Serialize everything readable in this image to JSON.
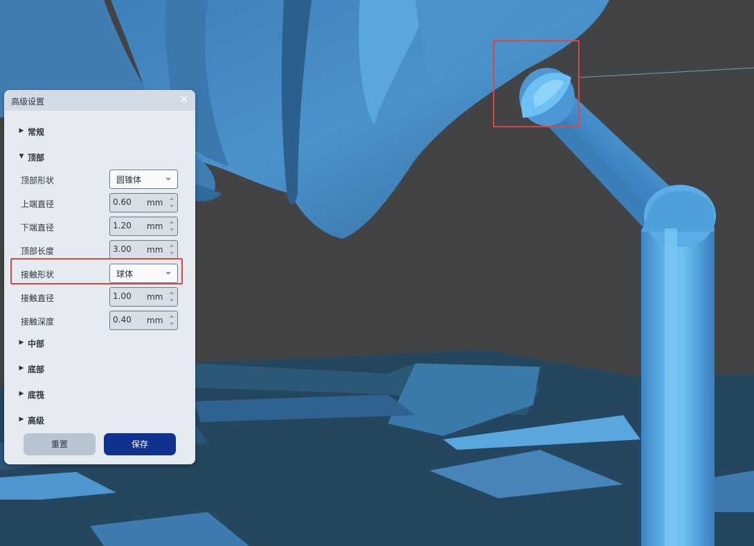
{
  "panel": {
    "title": "高级设置",
    "close_icon": "close-icon",
    "sections": {
      "general": "常规",
      "top": "顶部",
      "middle": "中部",
      "bottom": "底部",
      "raft": "底筏",
      "advanced": "高级"
    },
    "top_fields": {
      "top_shape": {
        "label": "顶部形状",
        "value": "圆锥体"
      },
      "upper_diameter": {
        "label": "上端直径",
        "value": "0.60",
        "unit": "mm"
      },
      "lower_diameter": {
        "label": "下端直径",
        "value": "1.20",
        "unit": "mm"
      },
      "top_length": {
        "label": "顶部长度",
        "value": "3.00",
        "unit": "mm"
      },
      "contact_shape": {
        "label": "接触形状",
        "value": "球体"
      },
      "contact_diameter": {
        "label": "接触直径",
        "value": "1.00",
        "unit": "mm"
      },
      "contact_depth": {
        "label": "接触深度",
        "value": "0.40",
        "unit": "mm"
      }
    },
    "buttons": {
      "reset": "重置",
      "save": "保存"
    }
  },
  "colors": {
    "viewport_background": "#414345",
    "model_blue": "#4a8ec6",
    "highlight_red": "#e0463f",
    "save_button": "#11328f"
  }
}
